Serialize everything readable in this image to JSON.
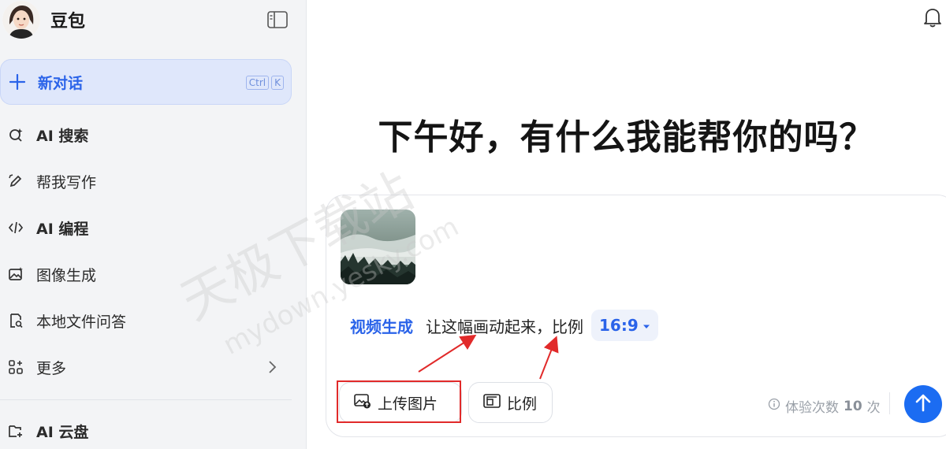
{
  "app": {
    "name": "豆包"
  },
  "sidebar": {
    "new_chat": {
      "label": "新对话",
      "shortcut": [
        "Ctrl",
        "K"
      ]
    },
    "items": [
      {
        "label": "AI 搜索",
        "icon": "search-spark-icon"
      },
      {
        "label": "帮我写作",
        "icon": "pen-icon"
      },
      {
        "label": "AI 编程",
        "icon": "code-icon"
      },
      {
        "label": "图像生成",
        "icon": "image-icon"
      },
      {
        "label": "本地文件问答",
        "icon": "file-search-icon"
      },
      {
        "label": "更多",
        "icon": "grid-plus-icon"
      },
      {
        "label": "AI 云盘",
        "icon": "cloud-drive-icon"
      }
    ]
  },
  "main": {
    "greeting": "下午好，有什么我能帮你的吗？",
    "composer": {
      "prompt_tag": "视频生成",
      "prompt_text": "让这幅画动起来，比例",
      "ratio_value": "16:9",
      "upload_label": "上传图片",
      "ratio_label": "比例",
      "quota_prefix": "体验次数",
      "quota_count": "10",
      "quota_suffix": "次"
    }
  },
  "watermark": {
    "line1": "天极下载站",
    "line2": "mydown.yesky.com"
  },
  "colors": {
    "accent": "#2a63e9",
    "send": "#1b6cf2",
    "annotation": "#e12a2a"
  }
}
